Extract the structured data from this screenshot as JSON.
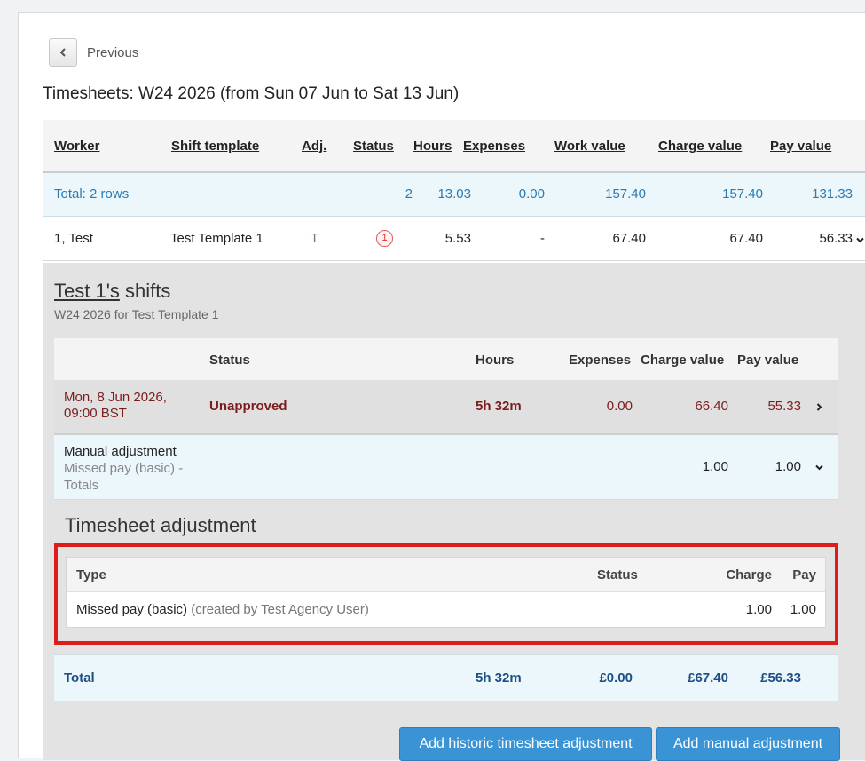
{
  "nav": {
    "previous_label": "Previous"
  },
  "page_title": "Timesheets: W24 2026 (from Sun 07 Jun to Sat 13 Jun)",
  "grid": {
    "headers": {
      "worker": "Worker",
      "shift_template": "Shift template",
      "adj": "Adj.",
      "status": "Status",
      "hours": "Hours",
      "expenses": "Expenses",
      "work_value": "Work value",
      "charge_value": "Charge value",
      "pay_value": "Pay value"
    },
    "total": {
      "label": "Total: 2 rows",
      "status": "2",
      "hours": "13.03",
      "expenses": "0.00",
      "work_value": "157.40",
      "charge_value": "157.40",
      "pay_value": "131.33"
    },
    "worker_row": {
      "worker": "1, Test",
      "shift_template": "Test Template 1",
      "adj": "T",
      "status_badge": "1",
      "hours": "5.53",
      "expenses": "-",
      "work_value": "67.40",
      "charge_value": "67.40",
      "pay_value": "56.33"
    }
  },
  "shifts": {
    "title_link": "Test 1's",
    "title_suffix": " shifts",
    "subtitle": "W24 2026 for Test Template 1",
    "headers": {
      "status": "Status",
      "hours": "Hours",
      "expenses": "Expenses",
      "charge_value": "Charge value",
      "pay_value": "Pay value"
    },
    "shift": {
      "date_line1": "Mon, 8 Jun 2026,",
      "date_line2": "09:00 BST",
      "status": "Unapproved",
      "hours": "5h 32m",
      "expenses": "0.00",
      "charge_value": "66.40",
      "pay_value": "55.33"
    },
    "manual": {
      "line1": "Manual adjustment",
      "line2": "Missed pay (basic) -",
      "line3": "Totals",
      "charge_value": "1.00",
      "pay_value": "1.00"
    },
    "adjustment": {
      "title": "Timesheet adjustment",
      "headers": {
        "type": "Type",
        "status": "Status",
        "charge": "Charge",
        "pay": "Pay"
      },
      "row": {
        "type": "Missed pay (basic)",
        "created_by": "(created by Test Agency User)",
        "charge": "1.00",
        "pay": "1.00"
      }
    },
    "total": {
      "label": "Total",
      "hours": "5h 32m",
      "expenses": "£0.00",
      "charge_value": "£67.40",
      "pay_value": "£56.33"
    }
  },
  "buttons": {
    "add_historic": "Add historic timesheet adjustment",
    "add_manual": "Add manual adjustment"
  },
  "colors": {
    "accent_button": "#3a93d4",
    "highlight_border": "#dd1c1c",
    "total_text": "#2b7ab1",
    "unapproved_text": "#7b1d1d"
  }
}
